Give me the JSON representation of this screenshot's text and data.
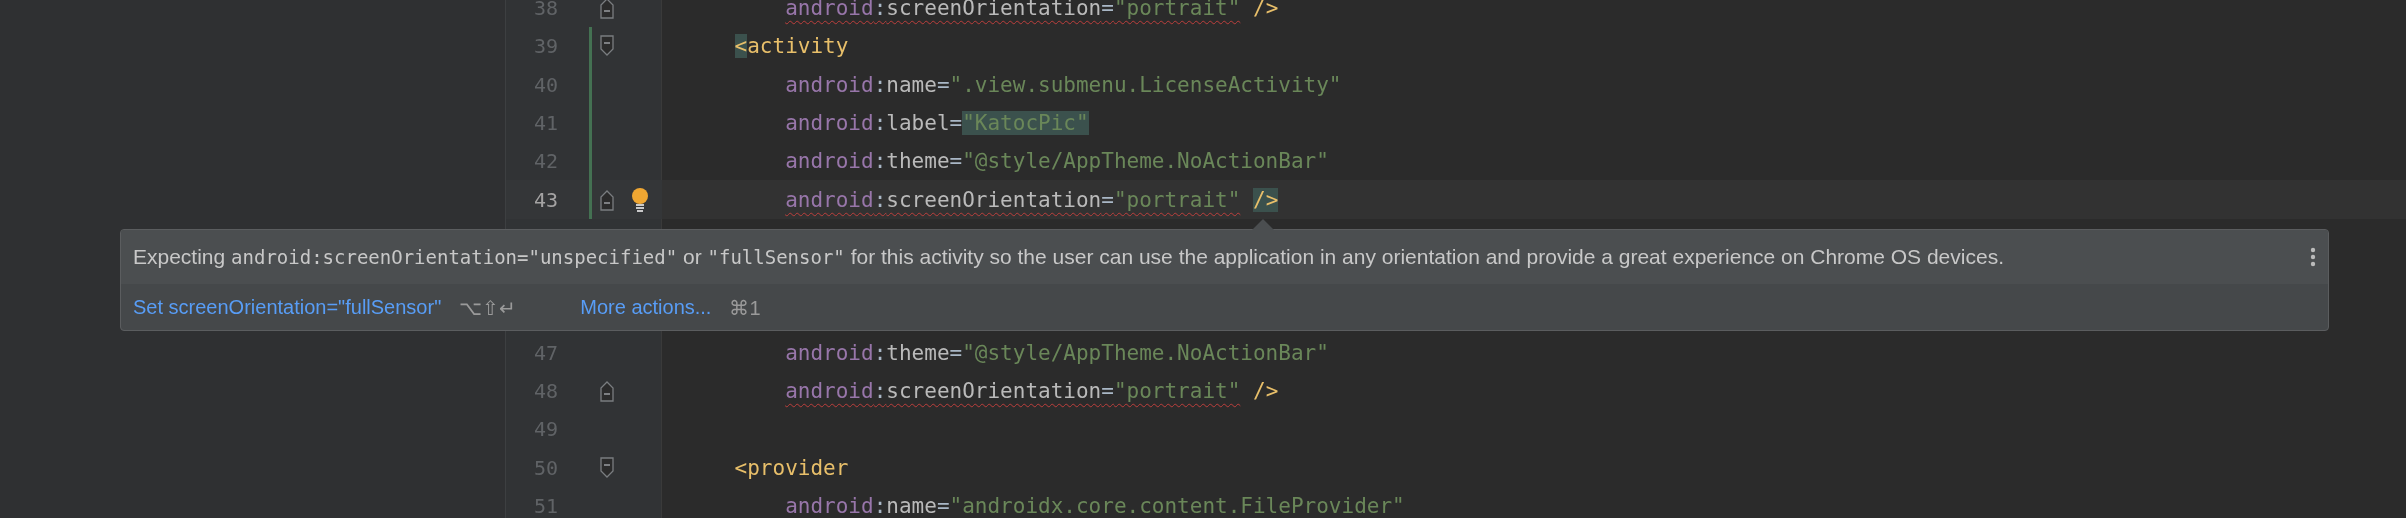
{
  "editor": {
    "lines_above": [
      {
        "number": "38",
        "current": false,
        "fold": {
          "kind": "end"
        },
        "changed": false,
        "warning": true,
        "tokens": [
          {
            "kind": "ns",
            "text": "android"
          },
          {
            "kind": "punct",
            "text": ":"
          },
          {
            "kind": "attr",
            "text": "screenOrientation"
          },
          {
            "kind": "punct",
            "text": "="
          },
          {
            "kind": "str",
            "text": "\"portrait\""
          },
          {
            "kind": "close",
            "text": "/>"
          }
        ]
      },
      {
        "number": "39",
        "current": false,
        "fold": {
          "kind": "start"
        },
        "changed": true,
        "warning": false,
        "tokens": [
          {
            "kind": "tag",
            "text": "<",
            "highlighted": true
          },
          {
            "kind": "tag",
            "text": "activity"
          }
        ]
      },
      {
        "number": "40",
        "current": false,
        "changed": true,
        "warning": false,
        "tokens": [
          {
            "kind": "ns",
            "text": "android"
          },
          {
            "kind": "punct",
            "text": ":"
          },
          {
            "kind": "attr",
            "text": "name"
          },
          {
            "kind": "punct",
            "text": "="
          },
          {
            "kind": "str",
            "text": "\".view.submenu.LicenseActivity\""
          }
        ]
      },
      {
        "number": "41",
        "current": false,
        "changed": true,
        "warning": false,
        "tokens": [
          {
            "kind": "ns",
            "text": "android"
          },
          {
            "kind": "punct",
            "text": ":"
          },
          {
            "kind": "attr",
            "text": "label"
          },
          {
            "kind": "punct",
            "text": "="
          },
          {
            "kind": "str",
            "text": "\"KatocPic\"",
            "highlighted": true
          }
        ]
      },
      {
        "number": "42",
        "current": false,
        "changed": true,
        "warning": false,
        "tokens": [
          {
            "kind": "ns",
            "text": "android"
          },
          {
            "kind": "punct",
            "text": ":"
          },
          {
            "kind": "attr",
            "text": "theme"
          },
          {
            "kind": "punct",
            "text": "="
          },
          {
            "kind": "str",
            "text": "\"@style/AppTheme.NoActionBar\""
          }
        ]
      },
      {
        "number": "43",
        "current": true,
        "fold": {
          "kind": "end"
        },
        "changed": true,
        "bulb": true,
        "warning": true,
        "tokens": [
          {
            "kind": "ns",
            "text": "android"
          },
          {
            "kind": "punct",
            "text": ":"
          },
          {
            "kind": "attr",
            "text": "screenOrientation"
          },
          {
            "kind": "punct",
            "text": "="
          },
          {
            "kind": "str",
            "text": "\"portrait\""
          },
          {
            "kind": "close",
            "text": "/>",
            "highlighted": true
          }
        ]
      }
    ],
    "lines_below": [
      {
        "number": "47",
        "current": false,
        "changed": false,
        "warning": false,
        "tokens": [
          {
            "kind": "ns",
            "text": "android"
          },
          {
            "kind": "punct",
            "text": ":"
          },
          {
            "kind": "attr",
            "text": "theme"
          },
          {
            "kind": "punct",
            "text": "="
          },
          {
            "kind": "str",
            "text": "\"@style/AppTheme.NoActionBar\""
          }
        ]
      },
      {
        "number": "48",
        "current": false,
        "fold": {
          "kind": "end"
        },
        "changed": false,
        "warning": true,
        "tokens": [
          {
            "kind": "ns",
            "text": "android"
          },
          {
            "kind": "punct",
            "text": ":"
          },
          {
            "kind": "attr",
            "text": "screenOrientation"
          },
          {
            "kind": "punct",
            "text": "="
          },
          {
            "kind": "str",
            "text": "\"portrait\""
          },
          {
            "kind": "close",
            "text": "/>"
          }
        ]
      },
      {
        "number": "49",
        "current": false,
        "changed": false
      },
      {
        "number": "50",
        "current": false,
        "fold": {
          "kind": "start"
        },
        "changed": false,
        "warning": false,
        "tokens": [
          {
            "kind": "tag",
            "text": "<provider"
          }
        ]
      },
      {
        "number": "51",
        "current": false,
        "changed": false,
        "tokens": [
          {
            "kind": "ns",
            "text": "android"
          },
          {
            "kind": "punct",
            "text": ":"
          },
          {
            "kind": "attr",
            "text": "name"
          },
          {
            "kind": "punct",
            "text": "="
          },
          {
            "kind": "str",
            "text": "\"androidx.core.content.FileProvider\""
          }
        ]
      }
    ]
  },
  "popup": {
    "message": [
      {
        "kind": "text",
        "text": "Expecting "
      },
      {
        "kind": "code",
        "text": "android:screenOrientation=\"unspecified\""
      },
      {
        "kind": "text",
        "text": " or "
      },
      {
        "kind": "code",
        "text": "\"fullSensor\""
      },
      {
        "kind": "text",
        "text": " for this activity so the user can use the application in any orientation and provide a great experience on Chrome OS devices."
      }
    ],
    "actions": [
      {
        "label": "Set screenOrientation=\"fullSensor\"",
        "shortcut": "⌥⇧↵"
      },
      {
        "label": "More actions...",
        "shortcut": "⌘1"
      }
    ]
  }
}
